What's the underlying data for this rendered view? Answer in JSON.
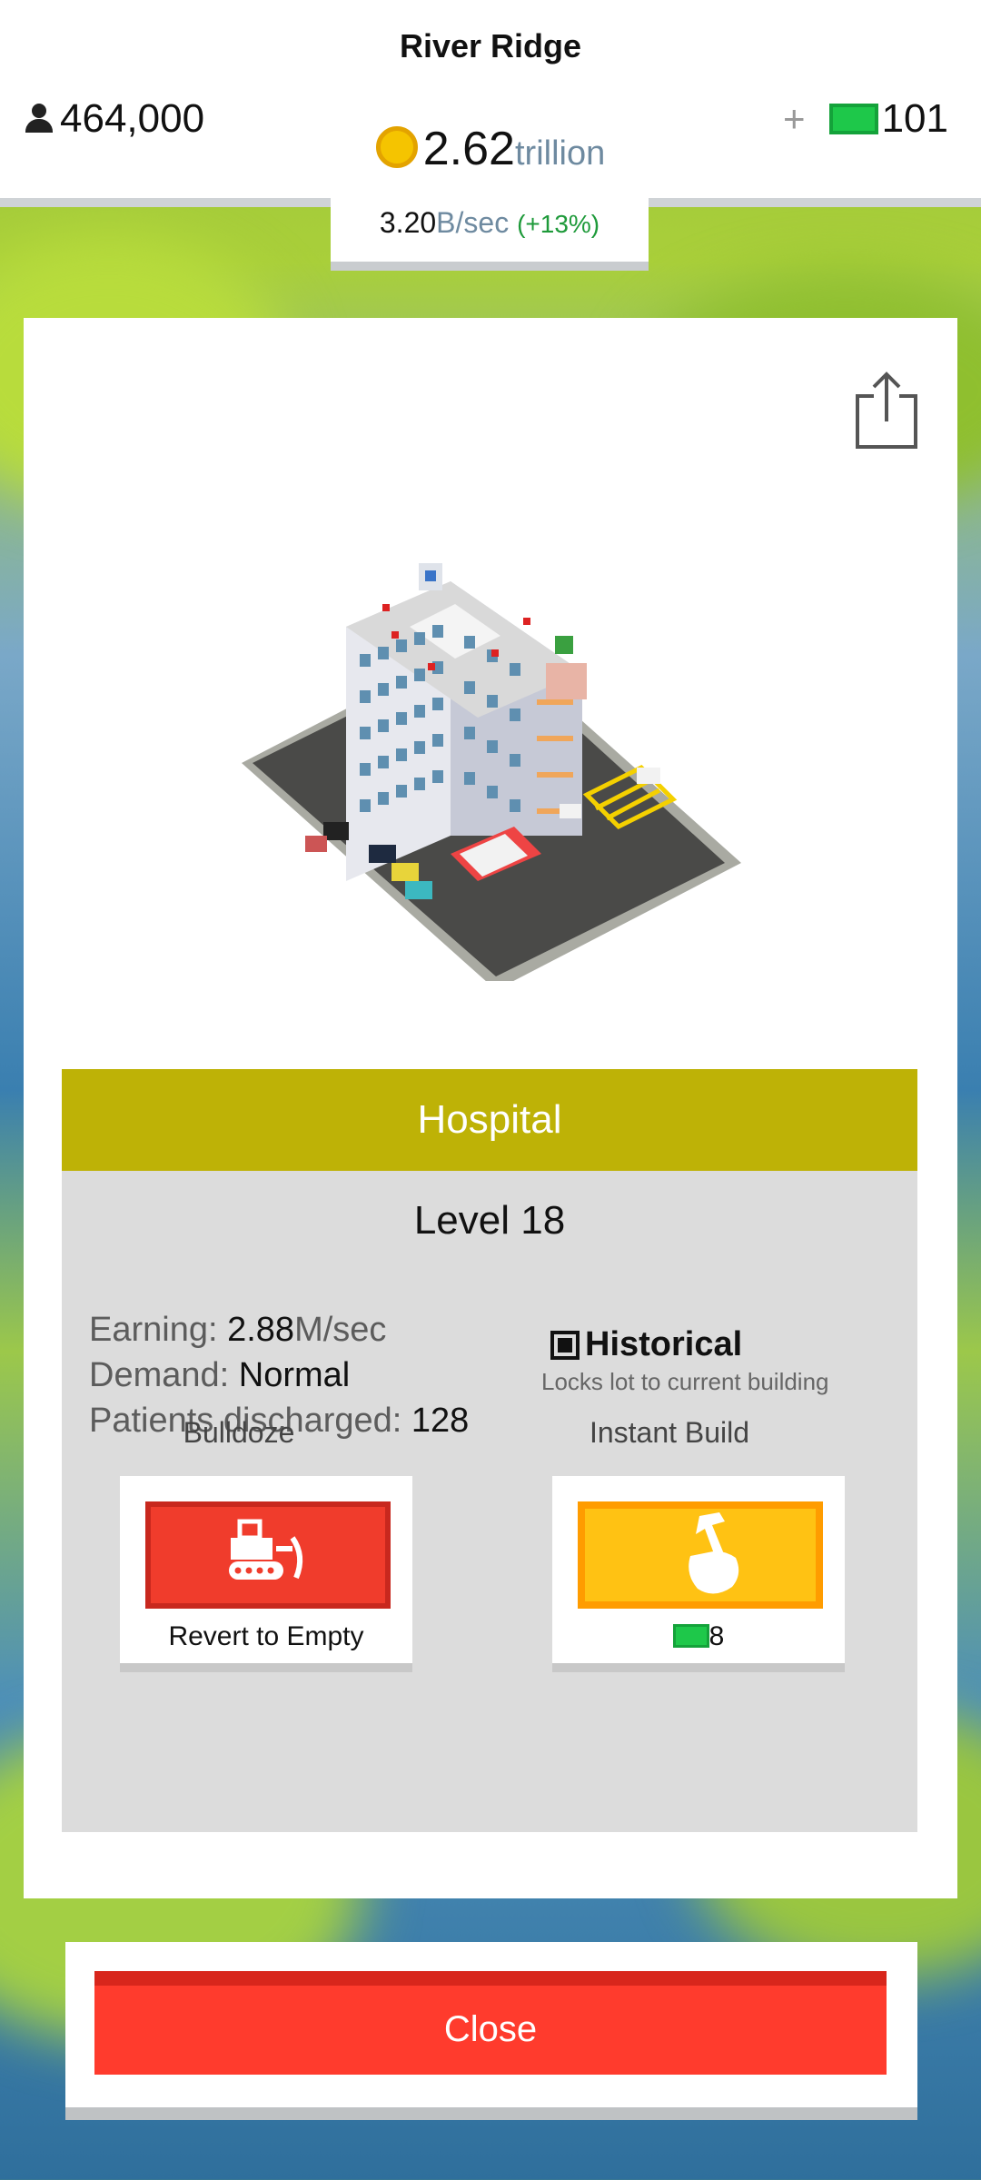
{
  "header": {
    "city_name": "River Ridge",
    "population": "464,000",
    "money_value": "2.62",
    "money_unit": "trillion",
    "gems_plus": "+",
    "gems_count": "101"
  },
  "income": {
    "value": "3.20",
    "unit": "B/sec",
    "change": "(+13%)"
  },
  "building": {
    "name": "Hospital",
    "level": "Level 18",
    "earning_label": "Earning:",
    "earning_value": "2.88",
    "earning_unit": "M/sec",
    "demand_label": "Demand:",
    "demand_value": "Normal",
    "patients_label": "Patients discharged:",
    "patients_value": "128",
    "historical_label": "Historical",
    "historical_sub": "Locks lot to current building",
    "historical_checked": true
  },
  "actions": {
    "bulldoze_title": "Bulldoze",
    "bulldoze_label": "Revert to Empty",
    "instant_title": "Instant Build",
    "instant_cost": "8"
  },
  "footer": {
    "close_label": "Close"
  },
  "colors": {
    "banner": "#beb206",
    "bulldoze": "#f03c2c",
    "instant": "#ffc213",
    "close": "#ff3b2d",
    "gem": "#1ec84a"
  },
  "icons": [
    "person-icon",
    "coin-icon",
    "gem-icon",
    "share-icon",
    "checkbox-icon",
    "bulldozer-icon",
    "hammer-hand-icon"
  ]
}
